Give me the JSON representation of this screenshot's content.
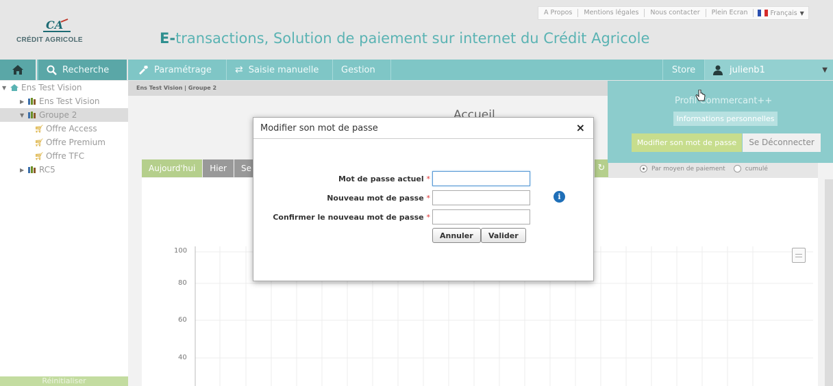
{
  "toplinks": [
    "A Propos",
    "Mentions légales",
    "Nous contacter",
    "Plein Ecran"
  ],
  "language": "Français",
  "brand": {
    "logo_mark": "CA",
    "logo_text": "CRÉDIT AGRICOLE",
    "title_prefix": "E-",
    "title_rest": "transactions, Solution de paiement sur internet du Crédit Agricole"
  },
  "nav": {
    "search": "Recherche",
    "parametrage": "Paramétrage",
    "saisie": "Saisie manuelle",
    "gestion": "Gestion",
    "store": "Store",
    "user": "julienb1"
  },
  "sidebar": {
    "items": [
      "Ens Test Vision",
      "Ens Test Vision",
      "Groupe 2",
      "Offre Access",
      "Offre Premium",
      "Offre TFC",
      "RC5"
    ],
    "reset": "Réinitialiser"
  },
  "breadcrumb": "Ens Test Vision  |  Groupe 2",
  "page_title": "Accueil",
  "tabs": [
    "Aujourd'hui",
    "Hier",
    "Se"
  ],
  "radios": {
    "by_payment": "Par moyen de paiement",
    "cumulative": "cumulé"
  },
  "chart": {
    "ticks": [
      "100",
      "80",
      "60",
      "40"
    ]
  },
  "profile": {
    "title": "Profil  Commercant++",
    "info": "Informations personnelles",
    "change_password": "Modifier son mot de passe",
    "logout": "Se Déconnecter"
  },
  "modal": {
    "title": "Modifier son mot de passe",
    "current_label": "Mot de passe actuel",
    "new_label": "Nouveau mot de passe",
    "confirm_label": "Confirmer le nouveau mot de passe",
    "required_mark": "*",
    "current_value": "",
    "new_value": "",
    "confirm_value": "",
    "cancel": "Annuler",
    "validate": "Valider",
    "close": "×"
  },
  "colors": {
    "teal": "#7fc6c6",
    "green": "#b5cf8c",
    "brand": "#2e8f8f"
  }
}
